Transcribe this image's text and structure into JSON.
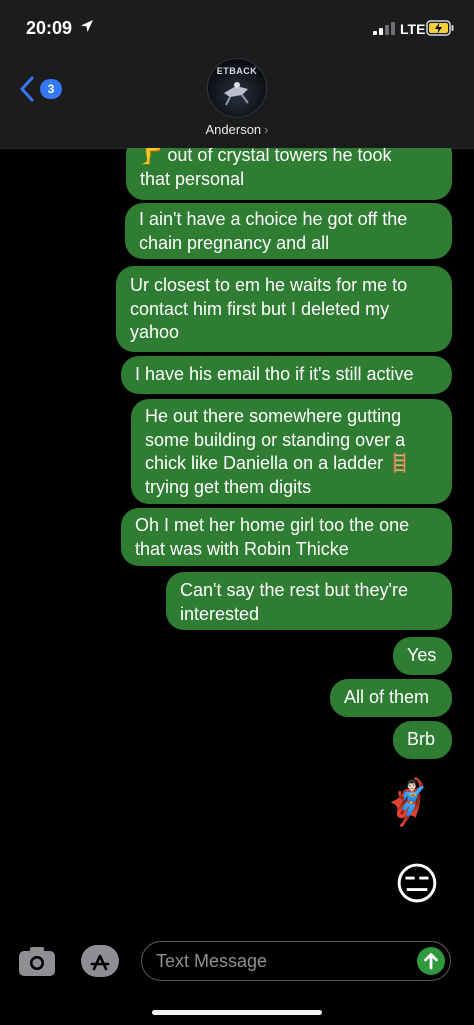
{
  "status_bar": {
    "time": "20:09",
    "network": "LTE"
  },
  "header": {
    "back_count": "3",
    "avatar_text": "ETBACK",
    "contact_name": "Anderson",
    "contact_chevron": "›"
  },
  "messages": [
    {
      "lines": [
        "🦵 out of crystal towers he took",
        "that personal"
      ]
    },
    {
      "lines": [
        "I ain't have a choice he got off the",
        "chain pregnancy and all"
      ]
    },
    {
      "lines": [
        "Ur closest to em he waits for me to",
        "contact him first but I deleted my",
        "yahoo"
      ]
    },
    {
      "lines": [
        "I have his email tho if it's still active"
      ]
    },
    {
      "lines": [
        "He out there somewhere gutting",
        "some building or standing over a",
        "chick like Daniella on a ladder 🪜",
        "trying get them digits"
      ]
    },
    {
      "lines": [
        "Oh I met her home girl too the one",
        "that was with Robin Thicke"
      ]
    },
    {
      "lines": [
        "Can't say the rest but they're",
        "interested"
      ]
    },
    {
      "lines": [
        "Yes"
      ]
    },
    {
      "lines": [
        "All of them"
      ]
    },
    {
      "lines": [
        "Brb"
      ]
    }
  ],
  "emojis": [
    "🦸🏻‍♂️",
    "😑"
  ],
  "input": {
    "placeholder": "Text Message"
  },
  "colors": {
    "bubble": "#2f7d32",
    "header_bg": "#1c1c1e",
    "accent_blue": "#3478f6",
    "send_green": "#2f9a3c"
  }
}
